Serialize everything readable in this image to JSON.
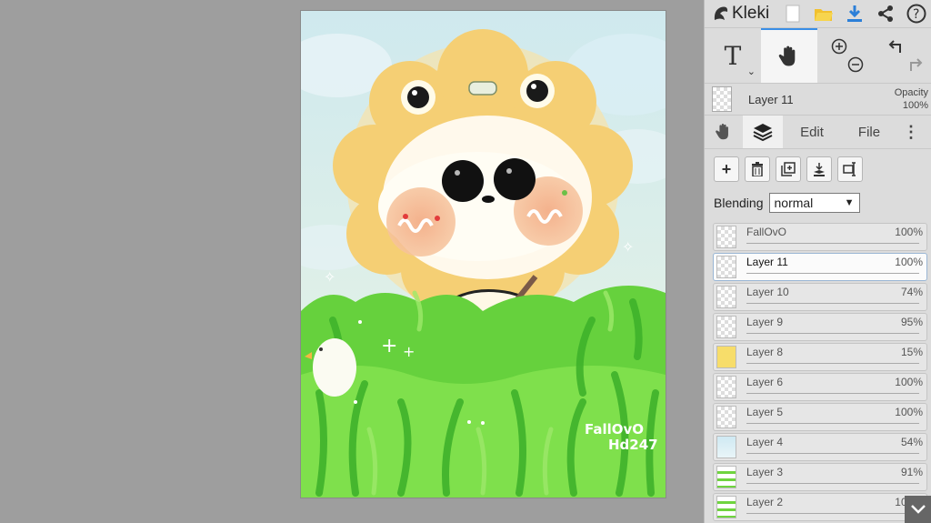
{
  "app": {
    "name": "Kleki"
  },
  "topbar": {
    "icons": [
      "new-image-icon",
      "open-folder-icon",
      "download-icon",
      "share-icon",
      "help-icon"
    ]
  },
  "tools": {
    "text_tool": "T",
    "hand_tool": "hand-icon",
    "zoom_in": "zoom-in-icon",
    "zoom_out": "zoom-out-icon",
    "undo": "undo-icon",
    "redo": "redo-icon"
  },
  "current_layer": {
    "name": "Layer 11",
    "opacity_label": "Opacity",
    "opacity_value": "100%"
  },
  "tabs": {
    "hand": "hand-icon",
    "layers": "layers-icon",
    "edit": "Edit",
    "file": "File"
  },
  "layer_actions": [
    "add-layer-icon",
    "delete-layer-icon",
    "duplicate-layer-icon",
    "merge-down-icon",
    "rename-layer-icon"
  ],
  "blending": {
    "label": "Blending",
    "value": "normal"
  },
  "layers": [
    {
      "name": "FallOvO",
      "opacity": "100%",
      "value": 1.0,
      "thumb": "transparent"
    },
    {
      "name": "Layer 11",
      "opacity": "100%",
      "value": 1.0,
      "thumb": "transparent",
      "selected": true
    },
    {
      "name": "Layer 10",
      "opacity": "74%",
      "value": 0.74,
      "thumb": "transparent"
    },
    {
      "name": "Layer 9",
      "opacity": "95%",
      "value": 0.95,
      "thumb": "transparent"
    },
    {
      "name": "Layer 8",
      "opacity": "15%",
      "value": 0.15,
      "thumb": "yellow"
    },
    {
      "name": "Layer 6",
      "opacity": "100%",
      "value": 1.0,
      "thumb": "transparent"
    },
    {
      "name": "Layer 5",
      "opacity": "100%",
      "value": 1.0,
      "thumb": "transparent"
    },
    {
      "name": "Layer 4",
      "opacity": "54%",
      "value": 0.54,
      "thumb": "sky"
    },
    {
      "name": "Layer 3",
      "opacity": "91%",
      "value": 0.91,
      "thumb": "grass"
    },
    {
      "name": "Layer 2",
      "opacity": "100%",
      "value": 1.0,
      "thumb": "grass"
    }
  ],
  "artwork": {
    "signature_line1": "FallOvO",
    "signature_line2": "Hd247"
  },
  "colors": {
    "accent": "#3a8ee6",
    "sky": "#bfe3ea",
    "lion_mane": "#f7cf6e",
    "grass": "#5fce3a"
  }
}
